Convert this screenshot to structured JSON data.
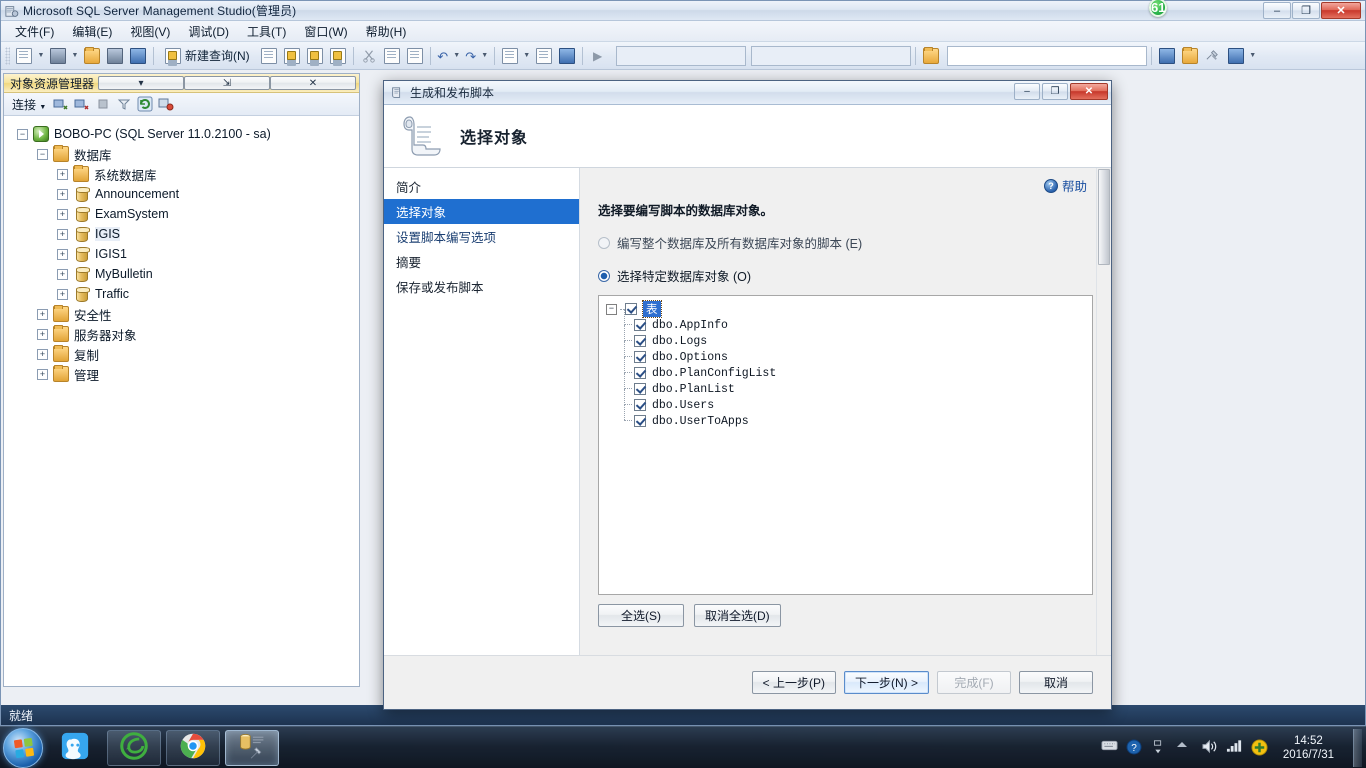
{
  "window": {
    "title": "Microsoft SQL Server Management Studio(管理员)",
    "app_icon": "ssms-icon",
    "badge": "61",
    "controls": {
      "minimize": "–",
      "maximize": "❐",
      "close": "✕"
    }
  },
  "menu": {
    "items": [
      {
        "label": "文件(F)",
        "name": "menu-file"
      },
      {
        "label": "编辑(E)",
        "name": "menu-edit"
      },
      {
        "label": "视图(V)",
        "name": "menu-view"
      },
      {
        "label": "调试(D)",
        "name": "menu-debug"
      },
      {
        "label": "工具(T)",
        "name": "menu-tools"
      },
      {
        "label": "窗口(W)",
        "name": "menu-window"
      },
      {
        "label": "帮助(H)",
        "name": "menu-help"
      }
    ]
  },
  "toolbar": {
    "new_query_label": "新建查询(N)",
    "combo1_value": "",
    "combo2_value": "",
    "combo3_value": ""
  },
  "object_explorer": {
    "title": "对象资源管理器",
    "connect_label": "连接",
    "tree": [
      {
        "label": "BOBO-PC (SQL Server 11.0.2100 - sa)",
        "icon": "server-icon",
        "indent": 0,
        "expander": "−"
      },
      {
        "label": "数据库",
        "icon": "folder-icon",
        "indent": 1,
        "expander": "−"
      },
      {
        "label": "系统数据库",
        "icon": "folder-icon",
        "indent": 2,
        "expander": "+"
      },
      {
        "label": "Announcement",
        "icon": "database-icon",
        "indent": 2,
        "expander": "+"
      },
      {
        "label": "ExamSystem",
        "icon": "database-icon",
        "indent": 2,
        "expander": "+"
      },
      {
        "label": "IGIS",
        "icon": "database-icon",
        "indent": 2,
        "expander": "+",
        "selected": true
      },
      {
        "label": "IGIS1",
        "icon": "database-icon",
        "indent": 2,
        "expander": "+"
      },
      {
        "label": "MyBulletin",
        "icon": "database-icon",
        "indent": 2,
        "expander": "+"
      },
      {
        "label": "Traffic",
        "icon": "database-icon",
        "indent": 2,
        "expander": "+"
      },
      {
        "label": "安全性",
        "icon": "folder-icon",
        "indent": 1,
        "expander": "+"
      },
      {
        "label": "服务器对象",
        "icon": "folder-icon",
        "indent": 1,
        "expander": "+"
      },
      {
        "label": "复制",
        "icon": "folder-icon",
        "indent": 1,
        "expander": "+"
      },
      {
        "label": "管理",
        "icon": "folder-icon",
        "indent": 1,
        "expander": "+"
      }
    ]
  },
  "status_bar": {
    "text": "就绪"
  },
  "dialog": {
    "title": "生成和发布脚本",
    "header_title": "选择对象",
    "help_label": "帮助",
    "nav": [
      {
        "label": "简介",
        "active": false
      },
      {
        "label": "选择对象",
        "active": true
      },
      {
        "label": "设置脚本编写选项",
        "active": false
      },
      {
        "label": "摘要",
        "active": false
      },
      {
        "label": "保存或发布脚本",
        "active": false
      }
    ],
    "instruction": "选择要编写脚本的数据库对象。",
    "radios": [
      {
        "label": "编写整个数据库及所有数据库对象的脚本 (E)",
        "checked": false
      },
      {
        "label": "选择特定数据库对象 (O)",
        "checked": true
      }
    ],
    "object_tree": {
      "root": {
        "label": "表",
        "checked": true,
        "expander": "−",
        "highlighted": true
      },
      "children": [
        {
          "label": "dbo.AppInfo",
          "checked": true
        },
        {
          "label": "dbo.Logs",
          "checked": true
        },
        {
          "label": "dbo.Options",
          "checked": true
        },
        {
          "label": "dbo.PlanConfigList",
          "checked": true
        },
        {
          "label": "dbo.PlanList",
          "checked": true
        },
        {
          "label": "dbo.Users",
          "checked": true
        },
        {
          "label": "dbo.UserToApps",
          "checked": true
        }
      ]
    },
    "select_buttons": [
      {
        "label": "全选(S)",
        "name": "select-all-button"
      },
      {
        "label": "取消全选(D)",
        "name": "deselect-all-button"
      }
    ],
    "footer_buttons": [
      {
        "label": "< 上一步(P)",
        "name": "back-button",
        "state": "normal"
      },
      {
        "label": "下一步(N) >",
        "name": "next-button",
        "state": "default"
      },
      {
        "label": "完成(F)",
        "name": "finish-button",
        "state": "disabled"
      },
      {
        "label": "取消",
        "name": "cancel-button",
        "state": "normal"
      }
    ],
    "controls": {
      "minimize": "–",
      "maximize": "❐",
      "close": "✕"
    }
  },
  "taskbar": {
    "start": "start-orb",
    "items": [
      {
        "name": "taskbar-item-qq",
        "icon": "qq-icon",
        "active": false
      },
      {
        "name": "taskbar-item-browser",
        "icon": "green-browser-icon",
        "active": false
      },
      {
        "name": "taskbar-item-chrome",
        "icon": "chrome-icon",
        "active": false
      },
      {
        "name": "taskbar-item-ssms",
        "icon": "ssms-icon",
        "active": true
      }
    ],
    "tray": [
      {
        "name": "tray-keyboard-icon"
      },
      {
        "name": "tray-help-icon"
      },
      {
        "name": "tray-network-flyout-icon"
      },
      {
        "name": "tray-show-hidden-icon"
      },
      {
        "name": "tray-volume-icon"
      },
      {
        "name": "tray-signal-icon"
      },
      {
        "name": "tray-security-icon"
      }
    ],
    "clock": {
      "time": "14:52",
      "date": "2016/7/31"
    }
  },
  "colors": {
    "accent": "#1f6fd0",
    "title_gold": "#f6e49c",
    "status_blue": "#1d3350",
    "close_red": "#c6372a"
  }
}
